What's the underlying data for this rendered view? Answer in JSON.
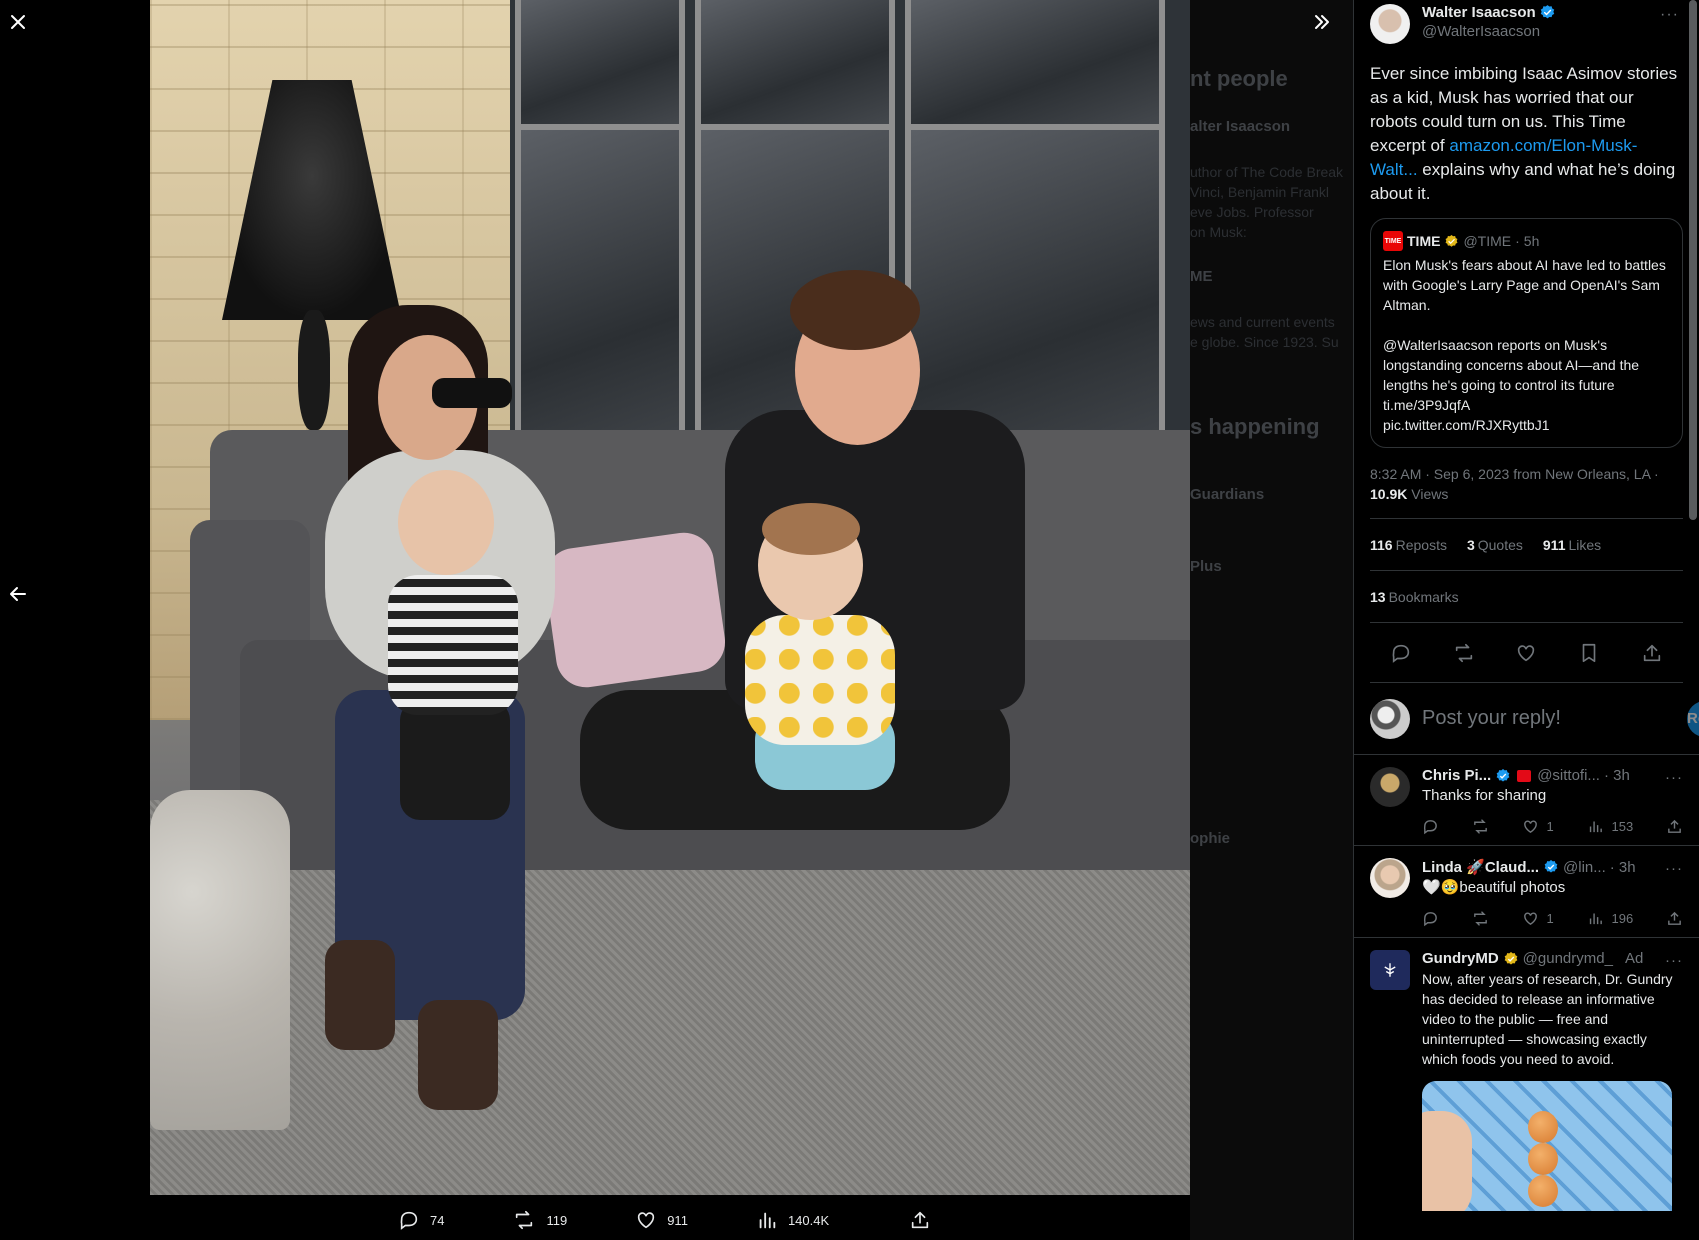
{
  "viewer": {
    "close_label": "Close",
    "prev_label": "Previous",
    "expand_label": "Expand",
    "stats": {
      "replies": "74",
      "reposts": "119",
      "likes": "911",
      "views": "140.4K"
    },
    "background_ghost": {
      "relevant": "nt people",
      "author": "alter Isaacson",
      "bio1": "uthor of The Code Break",
      "bio2": "Vinci, Benjamin Frankl",
      "bio3": "eve Jobs. Professor",
      "bio4": "on Musk:",
      "time": "ME",
      "news1": "ews and current events",
      "news2": "e globe. Since 1923. Su",
      "happening": "s happening",
      "guardians": "Guardians",
      "plus": "Plus",
      "sophie": "ophie"
    }
  },
  "author": {
    "name": "Walter Isaacson",
    "handle": "@WalterIsaacson",
    "more": "···"
  },
  "tweet": {
    "text_before": "Ever since imbibing Isaac Asimov stories as a kid, Musk has worried that our robots could turn on us.  This Time excerpt of ",
    "link": "amazon.com/Elon-Musk-Walt...",
    "text_after": " explains why and what he’s doing about it."
  },
  "quote": {
    "logo": "TIME",
    "name": "TIME",
    "handle": "@TIME",
    "time": "5h",
    "text": "Elon Musk's fears about AI have led to battles with Google's Larry Page and OpenAI's Sam Altman.\n\n@WalterIsaacson reports on Musk's longstanding concerns about AI—and the lengths he's going to control its future ti.me/3P9JqfA\npic.twitter.com/RJXRyttbJ1"
  },
  "meta": {
    "time": "8:32 AM · Sep 6, 2023 from New Orleans, LA · ",
    "views_count": "10.9K",
    "views_label": " Views"
  },
  "stats": {
    "reposts_count": "116",
    "reposts_label": "Reposts",
    "quotes_count": "3",
    "quotes_label": "Quotes",
    "likes_count": "911",
    "likes_label": "Likes",
    "bookmarks_count": "13",
    "bookmarks_label": "Bookmarks"
  },
  "reply_box": {
    "placeholder": "Post your reply!",
    "button": "Reply"
  },
  "replies": [
    {
      "name": "Chris Pi...",
      "handle": "@sittofi...",
      "time": "· 3h",
      "text": "Thanks for sharing",
      "likes": "1",
      "views": "153"
    },
    {
      "name": "Linda 🚀Claud...",
      "handle": "@lin...",
      "time": "· 3h",
      "text": "🤍🥹beautiful photos",
      "likes": "1",
      "views": "196"
    },
    {
      "name": "GundryMD",
      "handle": "@gundrymd_",
      "time": "Ad",
      "text": "Now, after years of research, Dr. Gundry has decided to release an informative video to the public — free and uninterrupted — showcasing exactly which foods you need to avoid."
    }
  ],
  "colors": {
    "accent": "#1d9bf0",
    "text": "#e7e9ea",
    "muted": "#71767b",
    "border": "#2f3336",
    "verified_gold": "#e2b719"
  }
}
